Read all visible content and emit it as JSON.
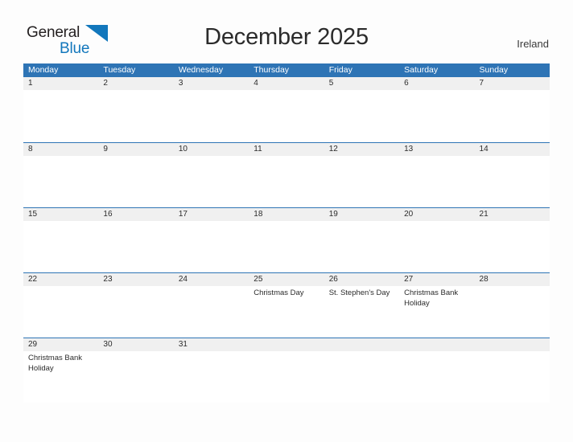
{
  "brand": {
    "name_part1": "General",
    "name_part2": "Blue",
    "triangle_icon": "blue-triangle-icon",
    "color_dark": "#231f20",
    "color_blue": "#1277bc"
  },
  "header": {
    "title": "December 2025",
    "country": "Ireland"
  },
  "calendar": {
    "header_color": "#2e74b5",
    "band_color": "#f0f0f0",
    "weekdays": [
      "Monday",
      "Tuesday",
      "Wednesday",
      "Thursday",
      "Friday",
      "Saturday",
      "Sunday"
    ],
    "weeks": [
      [
        {
          "date": "1",
          "events": []
        },
        {
          "date": "2",
          "events": []
        },
        {
          "date": "3",
          "events": []
        },
        {
          "date": "4",
          "events": []
        },
        {
          "date": "5",
          "events": []
        },
        {
          "date": "6",
          "events": []
        },
        {
          "date": "7",
          "events": []
        }
      ],
      [
        {
          "date": "8",
          "events": []
        },
        {
          "date": "9",
          "events": []
        },
        {
          "date": "10",
          "events": []
        },
        {
          "date": "11",
          "events": []
        },
        {
          "date": "12",
          "events": []
        },
        {
          "date": "13",
          "events": []
        },
        {
          "date": "14",
          "events": []
        }
      ],
      [
        {
          "date": "15",
          "events": []
        },
        {
          "date": "16",
          "events": []
        },
        {
          "date": "17",
          "events": []
        },
        {
          "date": "18",
          "events": []
        },
        {
          "date": "19",
          "events": []
        },
        {
          "date": "20",
          "events": []
        },
        {
          "date": "21",
          "events": []
        }
      ],
      [
        {
          "date": "22",
          "events": []
        },
        {
          "date": "23",
          "events": []
        },
        {
          "date": "24",
          "events": []
        },
        {
          "date": "25",
          "events": [
            "Christmas Day"
          ]
        },
        {
          "date": "26",
          "events": [
            "St. Stephen's Day"
          ]
        },
        {
          "date": "27",
          "events": [
            "Christmas Bank Holiday"
          ]
        },
        {
          "date": "28",
          "events": []
        }
      ],
      [
        {
          "date": "29",
          "events": [
            "Christmas Bank Holiday"
          ]
        },
        {
          "date": "30",
          "events": []
        },
        {
          "date": "31",
          "events": []
        },
        {
          "date": "",
          "events": []
        },
        {
          "date": "",
          "events": []
        },
        {
          "date": "",
          "events": []
        },
        {
          "date": "",
          "events": []
        }
      ]
    ]
  }
}
